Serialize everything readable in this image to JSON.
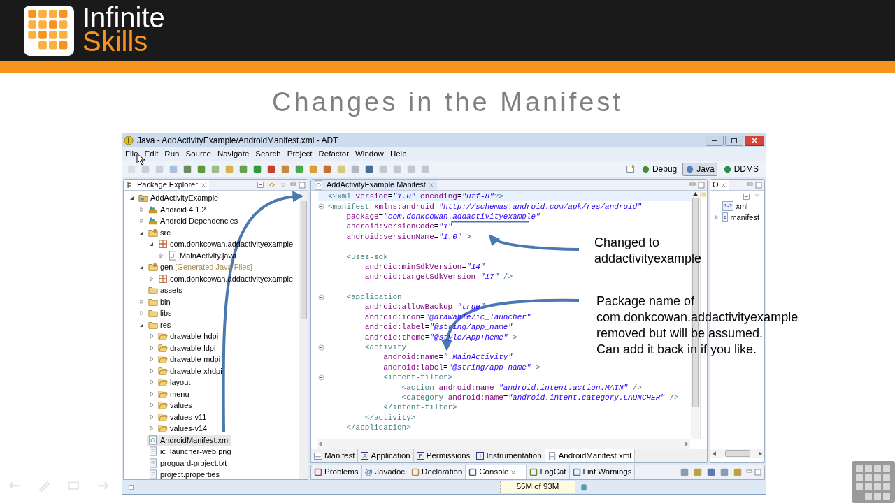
{
  "brand": {
    "first": "Infinite",
    "second": "Skills"
  },
  "slide_title": "Changes in the Manifest",
  "window": {
    "title": "Java - AddActivityExample/AndroidManifest.xml - ADT"
  },
  "menu": [
    "File",
    "Edit",
    "Run",
    "Source",
    "Navigate",
    "Search",
    "Project",
    "Refactor",
    "Window",
    "Help"
  ],
  "perspectives": [
    {
      "label": "Debug",
      "selected": false
    },
    {
      "label": "Java",
      "selected": true
    },
    {
      "label": "DDMS",
      "selected": false
    }
  ],
  "package_explorer": {
    "title": "Package Explorer",
    "tree": [
      {
        "label": "AddActivityExample",
        "kind": "project",
        "expanded": true,
        "selected": false,
        "children": [
          {
            "label": "Android 4.1.2",
            "kind": "library",
            "expanded": false,
            "selected": false
          },
          {
            "label": "Android Dependencies",
            "kind": "library",
            "expanded": false,
            "selected": false
          },
          {
            "label": "src",
            "kind": "source",
            "expanded": true,
            "selected": false,
            "children": [
              {
                "label": "com.donkcowan.addactivityexample",
                "kind": "package",
                "expanded": true,
                "selected": false,
                "children": [
                  {
                    "label": "MainActivity.java",
                    "kind": "java",
                    "expanded": false,
                    "selected": false
                  }
                ]
              }
            ]
          },
          {
            "label": "gen",
            "note": "[Generated Java Files]",
            "kind": "source",
            "expanded": true,
            "selected": false,
            "children": [
              {
                "label": "com.donkcowan.addactivityexample",
                "kind": "package",
                "expanded": false,
                "selected": false
              }
            ]
          },
          {
            "label": "assets",
            "kind": "folder",
            "selected": false
          },
          {
            "label": "bin",
            "kind": "folder",
            "expanded": false,
            "selected": false
          },
          {
            "label": "libs",
            "kind": "folder",
            "expanded": false,
            "selected": false
          },
          {
            "label": "res",
            "kind": "folder",
            "expanded": true,
            "selected": false,
            "children": [
              {
                "label": "drawable-hdpi",
                "kind": "subfolder",
                "expanded": false,
                "selected": false
              },
              {
                "label": "drawable-ldpi",
                "kind": "subfolder",
                "expanded": false,
                "selected": false
              },
              {
                "label": "drawable-mdpi",
                "kind": "subfolder",
                "expanded": false,
                "selected": false
              },
              {
                "label": "drawable-xhdpi",
                "kind": "subfolder",
                "expanded": false,
                "selected": false
              },
              {
                "label": "layout",
                "kind": "subfolder",
                "expanded": false,
                "selected": false
              },
              {
                "label": "menu",
                "kind": "subfolder",
                "expanded": false,
                "selected": false
              },
              {
                "label": "values",
                "kind": "subfolder",
                "expanded": false,
                "selected": false
              },
              {
                "label": "values-v11",
                "kind": "subfolder",
                "expanded": false,
                "selected": false
              },
              {
                "label": "values-v14",
                "kind": "subfolder",
                "expanded": false,
                "selected": false
              }
            ]
          },
          {
            "label": "AndroidManifest.xml",
            "kind": "xml",
            "selected": true
          },
          {
            "label": "ic_launcher-web.png",
            "kind": "file",
            "selected": false
          },
          {
            "label": "proguard-project.txt",
            "kind": "file",
            "selected": false
          },
          {
            "label": "project.properties",
            "kind": "file",
            "selected": false
          }
        ]
      }
    ]
  },
  "editor": {
    "tab": "AddActivityExample Manifest",
    "lines": [
      {
        "kind": "code",
        "current": true,
        "fold": false,
        "segments": [
          {
            "kind": "tag",
            "text": "<?xml"
          },
          {
            "kind": "attr",
            "text": " version"
          },
          {
            "kind": "plain",
            "text": "="
          },
          {
            "kind": "value",
            "text": "\"1.0\""
          },
          {
            "kind": "attr",
            "text": " encoding"
          },
          {
            "kind": "plain",
            "text": "="
          },
          {
            "kind": "value",
            "text": "\"utf-8\""
          },
          {
            "kind": "tag",
            "text": "?>"
          }
        ]
      },
      {
        "kind": "code",
        "current": false,
        "fold": true,
        "segments": [
          {
            "kind": "tag",
            "text": "<manifest"
          },
          {
            "kind": "attr",
            "text": " xmlns:android"
          },
          {
            "kind": "plain",
            "text": "="
          },
          {
            "kind": "value",
            "text": "\"http://schemas.android.com/apk/res/android\""
          }
        ],
        "children": [
          {
            "kind": "code",
            "current": false,
            "fold": false,
            "segments": [
              {
                "kind": "attr",
                "text": "package"
              },
              {
                "kind": "plain",
                "text": "="
              },
              {
                "kind": "value",
                "text": "\"com.donkcowan.addactivityexample\""
              }
            ]
          },
          {
            "kind": "code",
            "current": false,
            "fold": false,
            "segments": [
              {
                "kind": "attr",
                "text": "android:versionCode"
              },
              {
                "kind": "plain",
                "text": "="
              },
              {
                "kind": "value",
                "text": "\"1\""
              }
            ]
          },
          {
            "kind": "code",
            "current": false,
            "fold": false,
            "segments": [
              {
                "kind": "attr",
                "text": "android:versionName"
              },
              {
                "kind": "plain",
                "text": "="
              },
              {
                "kind": "value",
                "text": "\"1.0\""
              },
              {
                "kind": "tag",
                "text": " >"
              }
            ]
          },
          {
            "kind": "blank"
          },
          {
            "kind": "code",
            "current": false,
            "fold": false,
            "segments": [
              {
                "kind": "tag",
                "text": "<uses-sdk"
              }
            ],
            "children": [
              {
                "kind": "code",
                "current": false,
                "fold": false,
                "segments": [
                  {
                    "kind": "attr",
                    "text": "android:minSdkVersion"
                  },
                  {
                    "kind": "plain",
                    "text": "="
                  },
                  {
                    "kind": "value",
                    "text": "\"14\""
                  }
                ]
              },
              {
                "kind": "code",
                "current": false,
                "fold": false,
                "segments": [
                  {
                    "kind": "attr",
                    "text": "android:targetSdkVersion"
                  },
                  {
                    "kind": "plain",
                    "text": "="
                  },
                  {
                    "kind": "value",
                    "text": "\"17\""
                  },
                  {
                    "kind": "tag",
                    "text": " />"
                  }
                ]
              }
            ]
          },
          {
            "kind": "blank"
          },
          {
            "kind": "code",
            "current": false,
            "fold": true,
            "segments": [
              {
                "kind": "tag",
                "text": "<application"
              }
            ],
            "children": [
              {
                "kind": "code",
                "current": false,
                "fold": false,
                "segments": [
                  {
                    "kind": "attr",
                    "text": "android:allowBackup"
                  },
                  {
                    "kind": "plain",
                    "text": "="
                  },
                  {
                    "kind": "value",
                    "text": "\"true\""
                  }
                ]
              },
              {
                "kind": "code",
                "current": false,
                "fold": false,
                "segments": [
                  {
                    "kind": "attr",
                    "text": "android:icon"
                  },
                  {
                    "kind": "plain",
                    "text": "="
                  },
                  {
                    "kind": "value",
                    "text": "\"@drawable/ic_launcher\""
                  }
                ]
              },
              {
                "kind": "code",
                "current": false,
                "fold": false,
                "segments": [
                  {
                    "kind": "attr",
                    "text": "android:label"
                  },
                  {
                    "kind": "plain",
                    "text": "="
                  },
                  {
                    "kind": "value",
                    "text": "\"@string/app_name\""
                  }
                ]
              },
              {
                "kind": "code",
                "current": false,
                "fold": false,
                "segments": [
                  {
                    "kind": "attr",
                    "text": "android:theme"
                  },
                  {
                    "kind": "plain",
                    "text": "="
                  },
                  {
                    "kind": "value",
                    "text": "\"@style/AppTheme\""
                  },
                  {
                    "kind": "tag",
                    "text": " >"
                  }
                ]
              },
              {
                "kind": "code",
                "current": false,
                "fold": true,
                "segments": [
                  {
                    "kind": "tag",
                    "text": "<activity"
                  }
                ],
                "children": [
                  {
                    "kind": "code",
                    "current": false,
                    "fold": false,
                    "segments": [
                      {
                        "kind": "attr",
                        "text": "android:name"
                      },
                      {
                        "kind": "plain",
                        "text": "="
                      },
                      {
                        "kind": "value",
                        "text": "\".MainActivity\""
                      }
                    ]
                  },
                  {
                    "kind": "code",
                    "current": false,
                    "fold": false,
                    "segments": [
                      {
                        "kind": "attr",
                        "text": "android:label"
                      },
                      {
                        "kind": "plain",
                        "text": "="
                      },
                      {
                        "kind": "value",
                        "text": "\"@string/app_name\""
                      },
                      {
                        "kind": "tag",
                        "text": " >"
                      }
                    ]
                  },
                  {
                    "kind": "code",
                    "current": false,
                    "fold": true,
                    "segments": [
                      {
                        "kind": "tag",
                        "text": "<intent-filter>"
                      }
                    ],
                    "children": [
                      {
                        "kind": "code",
                        "current": false,
                        "fold": false,
                        "segments": [
                          {
                            "kind": "tag",
                            "text": "<action"
                          },
                          {
                            "kind": "attr",
                            "text": " android:name"
                          },
                          {
                            "kind": "plain",
                            "text": "="
                          },
                          {
                            "kind": "value",
                            "text": "\"android.intent.action.MAIN\""
                          },
                          {
                            "kind": "tag",
                            "text": " />"
                          }
                        ]
                      },
                      {
                        "kind": "code",
                        "current": false,
                        "fold": false,
                        "segments": [
                          {
                            "kind": "tag",
                            "text": "<category"
                          },
                          {
                            "kind": "attr",
                            "text": " android:name"
                          },
                          {
                            "kind": "plain",
                            "text": "="
                          },
                          {
                            "kind": "value",
                            "text": "\"android.intent.category.LAUNCHER\""
                          },
                          {
                            "kind": "tag",
                            "text": " />"
                          }
                        ]
                      }
                    ]
                  },
                  {
                    "kind": "code",
                    "current": false,
                    "fold": false,
                    "segments": [
                      {
                        "kind": "tag",
                        "text": "</intent-filter>"
                      }
                    ]
                  }
                ]
              },
              {
                "kind": "code",
                "current": false,
                "fold": false,
                "segments": [
                  {
                    "kind": "tag",
                    "text": "</activity>"
                  }
                ]
              }
            ]
          },
          {
            "kind": "code",
            "current": false,
            "fold": false,
            "segments": [
              {
                "kind": "tag",
                "text": "</application>"
              }
            ]
          }
        ]
      }
    ],
    "bottom_tabs": [
      {
        "label": "Manifest",
        "kind": "form",
        "selected": false
      },
      {
        "label": "Application",
        "kind": "letter",
        "letter": "A",
        "selected": false
      },
      {
        "label": "Permissions",
        "kind": "letter",
        "letter": "P",
        "selected": false
      },
      {
        "label": "Instrumentation",
        "kind": "letter",
        "letter": "I",
        "selected": false
      },
      {
        "label": "AndroidManifest.xml",
        "kind": "xml",
        "selected": true
      }
    ]
  },
  "outline": {
    "title": "O",
    "items": [
      {
        "label": "xml",
        "glyph": "?-?"
      },
      {
        "label": "manifest",
        "glyph": "e",
        "expanded": false
      }
    ]
  },
  "views": [
    {
      "label": "Problems",
      "selected": false
    },
    {
      "label": "Javadoc",
      "glyph": "@",
      "selected": false
    },
    {
      "label": "Declaration",
      "selected": false
    },
    {
      "label": "Console",
      "selected": true
    },
    {
      "label": "LogCat",
      "selected": false
    },
    {
      "label": "Lint Warnings",
      "selected": false
    }
  ],
  "status_bar": {
    "memory": "55M of 93M"
  },
  "annotations": [
    {
      "lines": [
        "Changed to",
        "addactivityexample"
      ]
    },
    {
      "lines": [
        "Package name of",
        "com.donkcowan.addactivityexample",
        "removed but will be assumed.",
        "Can add it back in if you like."
      ]
    }
  ]
}
